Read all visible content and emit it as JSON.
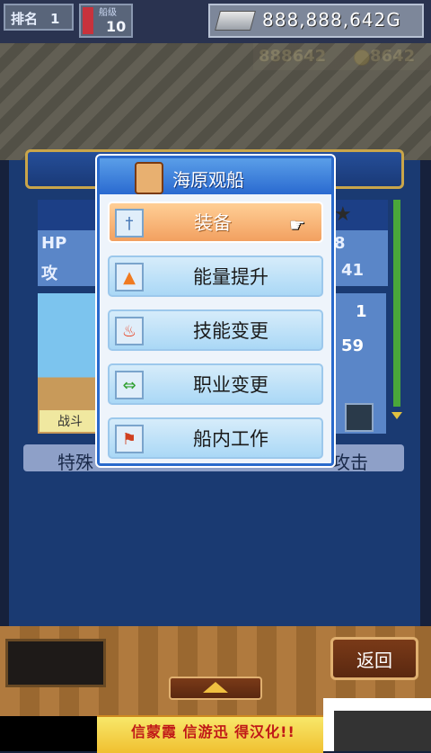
{
  "topbar": {
    "rank_label": "排名",
    "rank_value": "1",
    "level_label": "船级",
    "level_value": "10",
    "money": "888,888,642G",
    "sub_value_1": "888642",
    "sub_value_2": "8642"
  },
  "status_panel": {
    "hp_label": "HP",
    "attack_label": "攻",
    "hp_right": "8",
    "attack_right": "41",
    "side_value_1": "1",
    "side_value_2": "59",
    "battle_tag": "战斗",
    "special_left": "特殊",
    "special_right": "攻击"
  },
  "menu": {
    "title": "海原观船",
    "items": [
      {
        "label": "装备",
        "icon": "sword-icon",
        "selected": true
      },
      {
        "label": "能量提升",
        "icon": "up-arrow-icon",
        "selected": false
      },
      {
        "label": "技能变更",
        "icon": "fire-icon",
        "selected": false
      },
      {
        "label": "职业变更",
        "icon": "swap-arrows-icon",
        "selected": false
      },
      {
        "label": "船内工作",
        "icon": "flag-icon",
        "selected": false
      }
    ]
  },
  "bottom": {
    "back_label": "返回"
  },
  "banner": {
    "text": "信蒙霞 信游迅 得汉化!!"
  }
}
